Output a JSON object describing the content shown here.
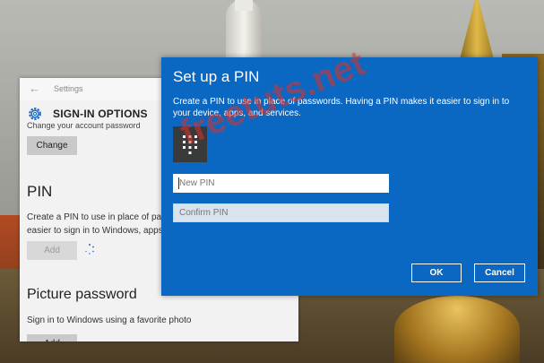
{
  "settings": {
    "app_name": "Settings",
    "page_title": "SIGN-IN OPTIONS",
    "partial_text": "Change your account password",
    "change_label": "Change",
    "pin_heading": "PIN",
    "pin_desc_line1": "Create a PIN to use in place of pass",
    "pin_desc_line2": "easier to sign in to Windows, apps, a",
    "add_label": "Add",
    "picture_password_heading": "Picture password",
    "picture_password_desc": "Sign in to Windows using a favorite photo",
    "add_label_2": "Add"
  },
  "dialog": {
    "title": "Set up a PIN",
    "description": "Create a PIN to use in place of passwords. Having a PIN makes it easier to sign in to your device, apps, and services.",
    "new_pin_placeholder": "New PIN",
    "confirm_pin_placeholder": "Confirm PIN",
    "ok_label": "OK",
    "cancel_label": "Cancel"
  },
  "watermark": "freetuts.net",
  "icons": {
    "back": "back-arrow-icon",
    "gear": "gear-icon",
    "keypad": "keypad-icon",
    "spinner": "loading-spinner-icon"
  },
  "colors": {
    "dialog_bg": "#0a67c2",
    "settings_bg": "#f2f2f2",
    "watermark": "#dc3228"
  }
}
